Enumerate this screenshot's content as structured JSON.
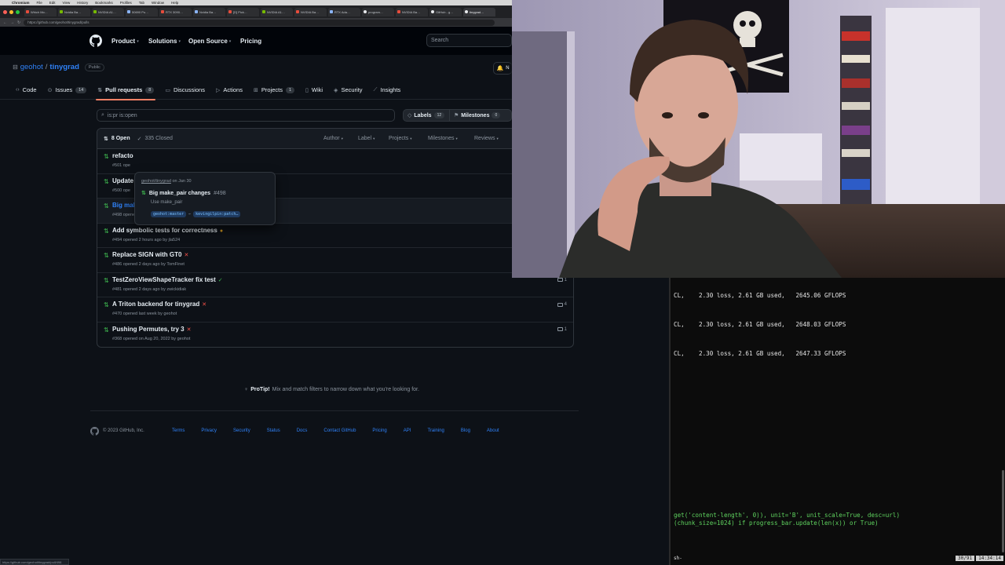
{
  "browser": {
    "menubar": [
      "Chromium",
      "File",
      "Edit",
      "View",
      "History",
      "Bookmarks",
      "Profiles",
      "Tab",
      "Window",
      "Help"
    ],
    "tabs": [
      "Which Mo…",
      "Nvidia Ba…",
      "NVIDIA A1…",
      "50690 Pu…",
      "RTX 3090…",
      "Nvidia Ba…",
      "[D] Pick…",
      "NVIDIA A1…",
      "NVIDIA Ba…",
      "RTX Ada…",
      "program…",
      "NVIDIA Ba…",
      "GitHub - g…",
      "tinygrad…"
    ],
    "url": "https://github.com/geohot/tinygrad/pulls",
    "status_url": "https://github.com/geohot/tinygrad/pull/498"
  },
  "github": {
    "topnav": {
      "product": "Product",
      "solutions": "Solutions",
      "open_source": "Open Source",
      "pricing": "Pricing",
      "search_placeholder": "Search"
    },
    "repo": {
      "owner": "geohot",
      "separator": "/",
      "name": "tinygrad",
      "visibility": "Public",
      "notifications_letter": "N"
    },
    "tabs": {
      "code": "Code",
      "issues": "Issues",
      "issues_count": "14",
      "pulls": "Pull requests",
      "pulls_count": "8",
      "discussions": "Discussions",
      "actions": "Actions",
      "projects": "Projects",
      "projects_count": "1",
      "wiki": "Wiki",
      "security": "Security",
      "insights": "Insights"
    },
    "filter": {
      "query": "is:pr is:open",
      "labels": "Labels",
      "labels_count": "12",
      "milestones": "Milestones",
      "milestones_count": "0"
    },
    "list_header": {
      "open": "8 Open",
      "closed": "335 Closed",
      "author": "Author",
      "label": "Label",
      "projects": "Projects",
      "milestones": "Milestones",
      "reviews": "Reviews"
    },
    "pulls": [
      {
        "title": "refacto",
        "meta": "#501 ope",
        "status": "",
        "status_class": "",
        "comments": ""
      },
      {
        "title": "Update",
        "meta": "#500 ope",
        "status": "",
        "status_class": "",
        "comments": ""
      },
      {
        "title": "Big make_pair changes",
        "meta": "#498 opened 19 minutes ago by kevingilpin",
        "status": "✓",
        "status_class": "st-ok",
        "comments": ""
      },
      {
        "title": "Add symbolic tests for correctness",
        "meta": "#494 opened 2 hours ago by jla524",
        "status": "●",
        "status_class": "st-pend",
        "comments": ""
      },
      {
        "title": "Replace SIGN with GT0",
        "meta": "#486 opened 2 days ago by TomFinet",
        "status": "✕",
        "status_class": "st-fail",
        "comments": ""
      },
      {
        "title": "TestZeroViewShapeTracker fix test",
        "meta": "#481 opened 2 days ago by zwickidiak",
        "status": "✓",
        "status_class": "st-ok",
        "comments": "1"
      },
      {
        "title": "A Triton backend for tinygrad",
        "meta": "#470 opened last week by geohot",
        "status": "✕",
        "status_class": "st-fail",
        "comments": "4"
      },
      {
        "title": "Pushing Permutes, try 3",
        "meta": "#368 opened on Aug 20, 2022 by geohot",
        "status": "✕",
        "status_class": "st-fail",
        "comments": "1"
      }
    ],
    "hovercard": {
      "repo": "geohot/tinygrad",
      "date": "on Jan 30",
      "title": "Big make_pair changes",
      "number": "#498",
      "description": "Use make_pair",
      "base_branch": "geohot:master",
      "arrow": "←",
      "head_branch": "kevingilpin:patch…"
    },
    "protip": {
      "label": "ProTip!",
      "text": "Mix and match filters to narrow down what you're looking for."
    },
    "footer": {
      "copyright": "© 2023 GitHub, Inc.",
      "links": [
        "Terms",
        "Privacy",
        "Security",
        "Status",
        "Docs",
        "Contact GitHub",
        "Pricing",
        "API",
        "Training",
        "Blog",
        "About"
      ]
    }
  },
  "terminal": {
    "lines": [
      "CL,    2.30 loss, 2.61 GB used,   2645.06 GFLOPS",
      "CL,    2.30 loss, 2.61 GB used,   2648.03 GFLOPS",
      "CL,    2.30 loss, 2.61 GB used,   2647.33 GFLOPS"
    ],
    "code_lines": [
      "get('content-length', 0)), unit='B', unit_scale=True, desc=url)",
      "(chunk_size=1024) if progress_bar.update(len(x)) or True)"
    ],
    "prompt": "sh-",
    "status_position": "30/91",
    "status_time": "14:34:14"
  },
  "colors": {
    "accent_link": "#2f81f7",
    "open_green": "#3fb950",
    "fail_red": "#f85149",
    "pending_yellow": "#d29922",
    "tab_underline": "#f78166"
  }
}
